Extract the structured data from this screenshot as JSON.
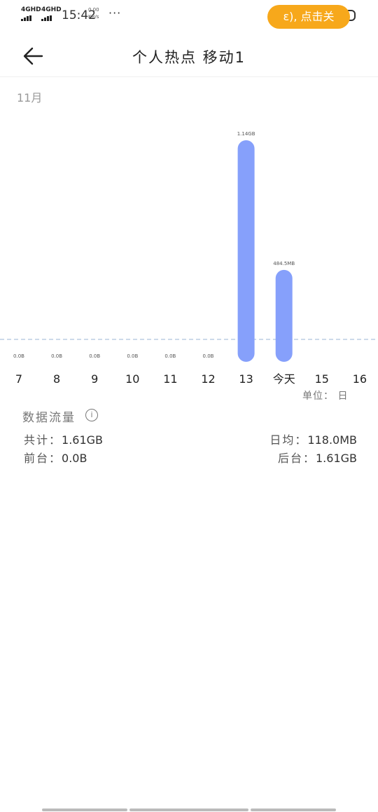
{
  "status_bar": {
    "sig1": "4GHD",
    "sig2": "4GHD",
    "time": "15:42",
    "net_speed_value": "0.00",
    "net_speed_unit": "KB/s",
    "more": "···",
    "pill_text": "ε),  点击关"
  },
  "header": {
    "title": "个人热点  移动1"
  },
  "month": "11月",
  "chart_data": {
    "type": "bar",
    "categories": [
      "7",
      "8",
      "9",
      "10",
      "11",
      "12",
      "13",
      "今天",
      "15",
      "16"
    ],
    "values_mb": [
      0,
      0,
      0,
      0,
      0,
      0,
      1167.4,
      484.5,
      null,
      null
    ],
    "data_labels": [
      "0.0B",
      "0.0B",
      "0.0B",
      "0.0B",
      "0.0B",
      "0.0B",
      "1.14GB",
      "484.5MB",
      "",
      ""
    ],
    "colors": {
      "bar": "#86a0fb",
      "baseline": "#9ab4d4"
    }
  },
  "unit": "单位：  日",
  "stats": {
    "title": "数据流量",
    "info_icon": "info-icon",
    "total_label": "共计：",
    "total_value": "1.61GB",
    "daily_label": "日均：",
    "daily_value": "118.0MB",
    "fore_label": "前台：",
    "fore_value": "0.0B",
    "back_label": "后台：",
    "back_value": "1.61GB"
  }
}
